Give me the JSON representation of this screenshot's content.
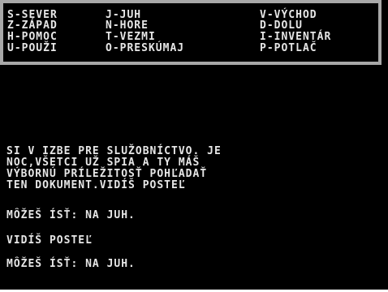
{
  "commands": {
    "row1": [
      "S-SEVER",
      "J-JUH",
      "V-VÝCHOD"
    ],
    "row2": [
      "Z-ZÁPAD",
      "N-HORE",
      "D-DOLU"
    ],
    "row3": [
      "H-POMOC",
      "T-VEZMI",
      "I-INVENTÁR"
    ],
    "row4": [
      "U-POUŽI",
      "O-PRESKÚMAJ",
      "P-POTLAČ"
    ]
  },
  "output": {
    "description": [
      "SI V IZBE PRE SLUŽOBNÍCTVO. JE",
      "NOC,VŠETCI UŽ SPIA A TY MÁŠ",
      "VÝBORNÚ PRÍLEŽITOSŤ POHĽADAŤ",
      "TEN DOKUMENT.VIDÍŠ POSTEĽ"
    ],
    "exits_1": "MÔŽEŠ ÍSŤ: NA JUH.",
    "see": "VIDÍŠ POSTEĽ",
    "exits_2": "MÔŽEŠ ÍSŤ: NA JUH."
  },
  "colors": {
    "background": "#000000",
    "text": "#e6e6e6",
    "frame": "#a8a8a8"
  }
}
